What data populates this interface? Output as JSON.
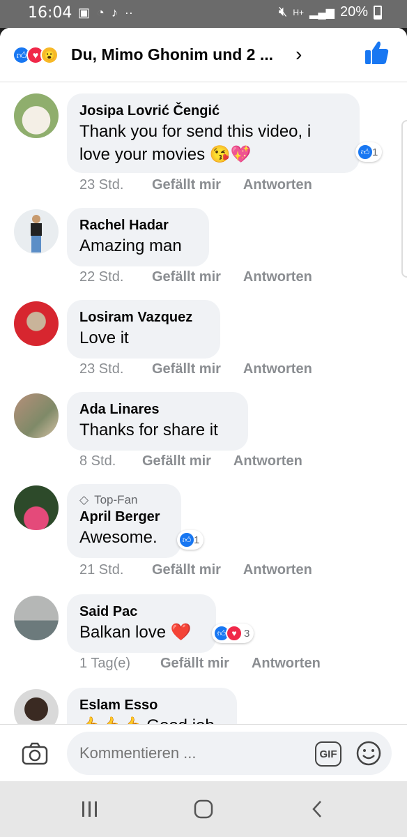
{
  "status_bar": {
    "time": "16:04",
    "battery": "20%",
    "network": "H+"
  },
  "header": {
    "summary": "Du, Mimo Ghonim und 2 ...",
    "chevron": "›"
  },
  "comments": [
    {
      "name": "Josipa Lovrić Čengić",
      "text_line1": "Thank you for send this video, i",
      "text_line2": "love your movies 😘💖",
      "time": "23 Std.",
      "reaction_count": "1"
    },
    {
      "name": "Rachel Hadar",
      "text": "Amazing man",
      "time": "22 Std."
    },
    {
      "name": "Losiram Vazquez",
      "text": "Love it",
      "time": "23 Std."
    },
    {
      "name": "Ada Linares",
      "text": "Thanks for share it",
      "time": "8 Std."
    },
    {
      "badge": "Top-Fan",
      "name": "April Berger",
      "text": "Awesome.",
      "time": "21 Std.",
      "reaction_count": "1"
    },
    {
      "name": "Said Pac",
      "text": "Balkan love ❤️",
      "time": "1 Tag(e)",
      "reaction_count": "3"
    },
    {
      "name": "Eslam Esso",
      "text": "👍👍👍 Good job"
    }
  ],
  "actions": {
    "like": "Gefällt mir",
    "reply": "Antworten"
  },
  "composer": {
    "placeholder": "Kommentieren ...",
    "gif_label": "GIF"
  },
  "colors": {
    "like_blue": "#1877f2",
    "love_red": "#f02849",
    "bubble_bg": "#f0f2f5",
    "meta_gray": "#8a8d91"
  }
}
